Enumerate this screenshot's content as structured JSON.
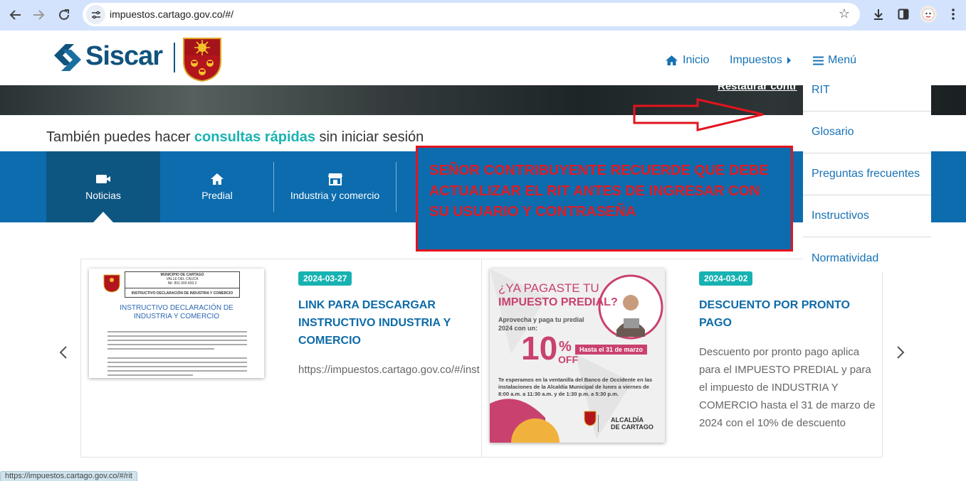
{
  "browser": {
    "url": "impuestos.cartago.gov.co/#/",
    "status_url": "https://impuestos.cartago.gov.co/#/rit"
  },
  "header": {
    "brand": "Siscar",
    "nav": {
      "inicio": "Inicio",
      "impuestos": "Impuestos",
      "menu": "Menú"
    }
  },
  "hero": {
    "link_text": "Restaurar contr"
  },
  "tagline": {
    "before": "También puedes hacer ",
    "highlight": "consultas rápidas",
    "after": " sin iniciar sesión"
  },
  "quick_tabs": [
    {
      "label": "Noticias",
      "icon": "video-camera-icon"
    },
    {
      "label": "Predial",
      "icon": "home-icon"
    },
    {
      "label": "Industria y comercio",
      "icon": "store-icon"
    }
  ],
  "notice": {
    "lines": [
      "SEÑOR CONTRIBUYENTE RECUERDE QUE DEBE",
      "ACTUALIZAR EL RIT  ANTES DE INGRESAR CON",
      "SU USUARIO Y CONTRASEÑA"
    ]
  },
  "menu_dropdown": {
    "items": [
      "RIT",
      "Glosario",
      "Preguntas frecuentes",
      "Instructivos",
      "Normatividad"
    ]
  },
  "news": [
    {
      "date": "2024-03-27",
      "title": "LINK PARA DESCARGAR INSTRUCTIVO INDUSTRIA Y COMERCIO",
      "body": "https://impuestos.cartago.gov.co/#/inst",
      "thumb": {
        "header_line1": "MUNICIPIO DE CARTAGO",
        "header_line2": "VALLE DEL CAUCA",
        "header_line3": "Nit: 891.900.493.2",
        "doc_title_bar": "INSTRUCTIVO DECLARACIÓN DE INDUSTRIA Y COMERCIO",
        "doc_heading": "INSTRUCTIVO DECLARACIÓN DE INDUSTRIA Y COMERCIO"
      }
    },
    {
      "date": "2024-03-02",
      "title": "DESCUENTO POR PRONTO PAGO",
      "body": "Descuento por pronto pago aplica para el IMPUESTO PREDIAL y para el impuesto de INDUSTRIA Y COMERCIO hasta el 31 de marzo de 2024 con el 10% de descuento",
      "thumb": {
        "headline1": "¿YA PAGASTE TU",
        "headline2": "IMPUESTO PREDIAL?",
        "sub": "Aprovecha y paga tu predial 2024 con un:",
        "big": "10",
        "pct": "%",
        "off": "OFF",
        "deadline": "Hasta el 31 de marzo",
        "info": "Te esperamos en la ventanilla del Banco de Occidente en las instalaciones de la Alcaldía Municipal de lunes a viernes de 8:00 a.m. a 11:30 a.m. y de 1:30 p.m. a 5:30 p.m.",
        "org1": "ALCALDÍA",
        "org2": "DE CARTAGO"
      }
    }
  ],
  "colors": {
    "primary_blue": "#0c6cae",
    "active_tab": "#0e5682",
    "teal": "#17b2b2",
    "alert_red": "#e2141e",
    "link_blue": "#1772b5"
  }
}
